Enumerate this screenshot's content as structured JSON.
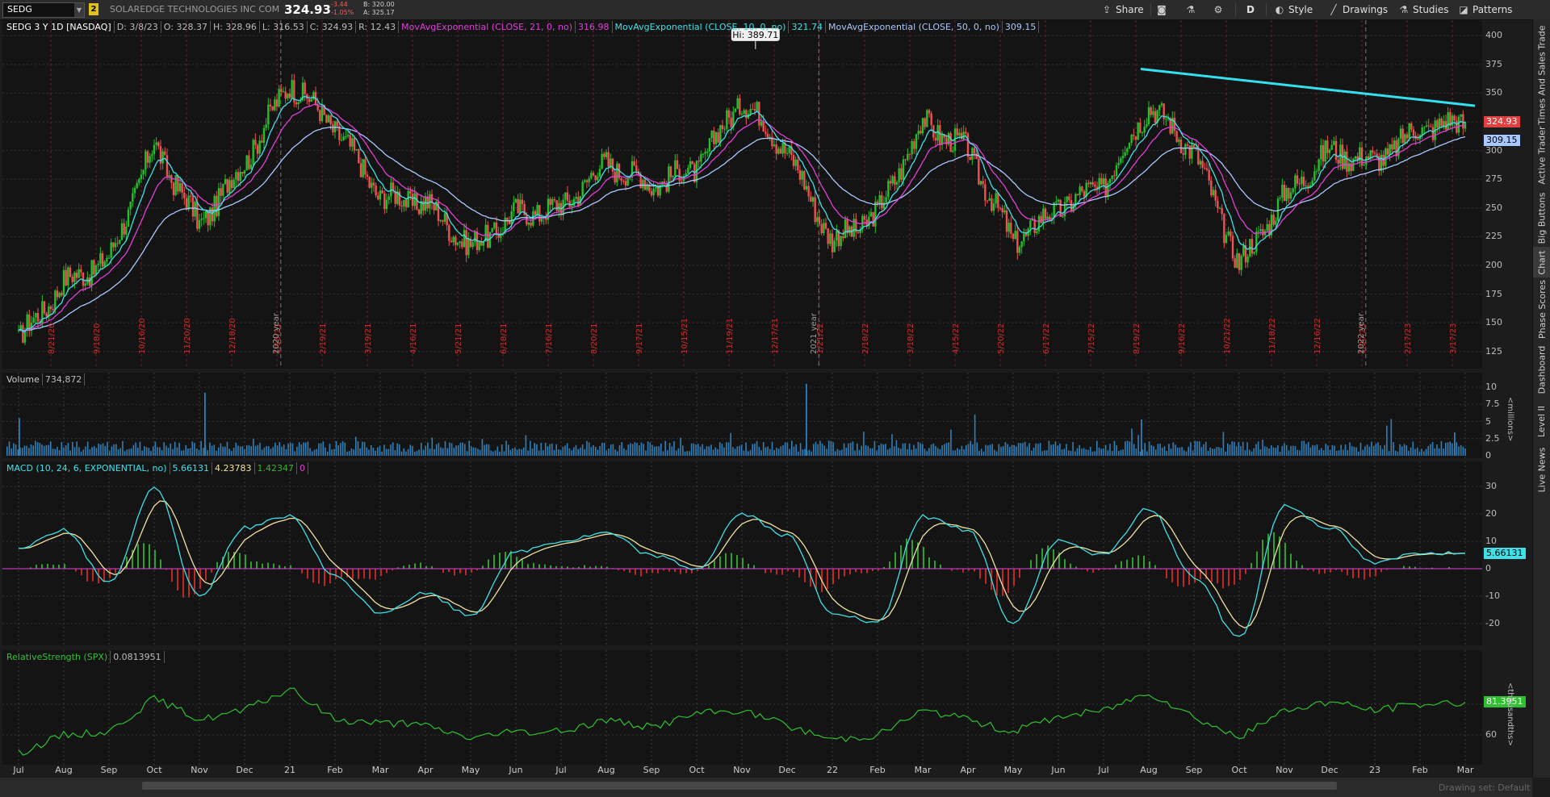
{
  "toolbar": {
    "symbol": "SEDG",
    "link_badge": "2",
    "company": "SOLAREDGE TECHNOLOGIES INC COM",
    "last": "324.93",
    "net_change": "-3.44",
    "pct_change": "-1.05%",
    "bid": "B: 320.00",
    "ask": "A: 325.17",
    "share_label": "Share",
    "period_label": "D",
    "style_label": "Style",
    "drawings_label": "Drawings",
    "studies_label": "Studies",
    "patterns_label": "Patterns"
  },
  "sidebar": {
    "tabs": [
      "Trade",
      "Times And Sales",
      "Active Trader",
      "Big Buttons",
      "Chart",
      "Phase Scores",
      "Dashboard",
      "Level II",
      "Live News"
    ],
    "active": "Chart"
  },
  "price_panel": {
    "header": [
      {
        "text": "SEDG 3 Y 1D [NASDAQ]",
        "color": "#ffffff"
      },
      {
        "text": "D: 3/8/23",
        "color": "#bbbbbb"
      },
      {
        "text": "O: 328.37",
        "color": "#bbbbbb"
      },
      {
        "text": "H: 328.96",
        "color": "#bbbbbb"
      },
      {
        "text": "L: 316.53",
        "color": "#bbbbbb"
      },
      {
        "text": "C: 324.93",
        "color": "#bbbbbb"
      },
      {
        "text": "R: 12.43",
        "color": "#bbbbbb"
      },
      {
        "text": "MovAvgExponential (CLOSE, 21, 0, no)",
        "color": "#e040d8"
      },
      {
        "text": "316.98",
        "color": "#e040d8"
      },
      {
        "text": "MovAvgExponential (CLOSE, 10, 0, no)",
        "color": "#40e0e8"
      },
      {
        "text": "321.74",
        "color": "#40e0e8"
      },
      {
        "text": "MovAvgExponential (CLOSE, 50, 0, no)",
        "color": "#a8c8ff"
      },
      {
        "text": "309.15",
        "color": "#a8c8ff"
      }
    ],
    "hi_label": "Hi: 389.71",
    "last_price_label": "324.93",
    "ma50_label": "309.15",
    "y_ticks": [
      "400",
      "375",
      "350",
      "325",
      "300",
      "275",
      "250",
      "225",
      "200",
      "175",
      "150",
      "125"
    ],
    "vertical_dates": [
      "8/21/20",
      "9/18/20",
      "10/16/20",
      "11/20/20",
      "12/18/20",
      "1/15/21",
      "2/19/21",
      "3/19/21",
      "4/16/21",
      "5/21/21",
      "6/18/21",
      "7/16/21",
      "8/20/21",
      "9/17/21",
      "10/15/21",
      "11/19/21",
      "12/17/21",
      "1/21/22",
      "2/18/22",
      "3/18/22",
      "4/15/22",
      "5/20/22",
      "6/17/22",
      "7/15/22",
      "8/19/22",
      "9/16/22",
      "10/21/22",
      "11/18/22",
      "12/16/22",
      "1/20/23",
      "2/17/23",
      "3/17/23"
    ],
    "year_markers": [
      "2020 year",
      "2021 year",
      "2022 year"
    ]
  },
  "volume_panel": {
    "header": [
      {
        "text": "Volume",
        "color": "#cccccc"
      },
      {
        "text": "734,872",
        "color": "#bbbbbb"
      }
    ],
    "y_ticks": [
      "10",
      "7.5",
      "5",
      "2.5",
      "0"
    ],
    "unit": "<millions>"
  },
  "macd_panel": {
    "header": [
      {
        "text": "MACD (10, 24, 6, EXPONENTIAL, no)",
        "color": "#40e0e8"
      },
      {
        "text": "5.66131",
        "color": "#40e0e8"
      },
      {
        "text": "4.23783",
        "color": "#f0e0a0"
      },
      {
        "text": "1.42347",
        "color": "#3ab03a"
      },
      {
        "text": "0",
        "color": "#e040d8"
      }
    ],
    "y_ticks": [
      "30",
      "20",
      "10",
      "0",
      "-10",
      "-20"
    ],
    "value_label": "5.66131"
  },
  "rs_panel": {
    "header": [
      {
        "text": "RelativeStrength (SPX)",
        "color": "#35c035"
      },
      {
        "text": "0.0813951",
        "color": "#bbbbbb"
      }
    ],
    "y_ticks": [
      "60"
    ],
    "value_label": "81.3951",
    "unit": "<thousandths>"
  },
  "x_axis": [
    "Jul",
    "Aug",
    "Sep",
    "Oct",
    "Nov",
    "Dec",
    "21",
    "Feb",
    "Mar",
    "Apr",
    "May",
    "Jun",
    "Jul",
    "Aug",
    "Sep",
    "Oct",
    "Nov",
    "Dec",
    "22",
    "Feb",
    "Mar",
    "Apr",
    "May",
    "Jun",
    "Jul",
    "Aug",
    "Sep",
    "Oct",
    "Nov",
    "Dec",
    "23",
    "Feb",
    "Mar"
  ],
  "status": {
    "drawing_set": "Drawing set: Default"
  },
  "chart_data": {
    "type": "line",
    "title": "SEDG 3 Y 1D [NASDAQ]",
    "x": [
      "Jul 20",
      "Aug 20",
      "Sep 20",
      "Oct 20",
      "Nov 20",
      "Dec 20",
      "Jan 21",
      "Feb 21",
      "Mar 21",
      "Apr 21",
      "May 21",
      "Jun 21",
      "Jul 21",
      "Aug 21",
      "Sep 21",
      "Oct 21",
      "Nov 21",
      "Dec 21",
      "Jan 22",
      "Feb 22",
      "Mar 22",
      "Apr 22",
      "May 22",
      "Jun 22",
      "Jul 22",
      "Aug 22",
      "Sep 22",
      "Oct 22",
      "Nov 22",
      "Dec 22",
      "Jan 23",
      "Feb 23",
      "Mar 23"
    ],
    "series": [
      {
        "name": "SEDG",
        "values": [
          135,
          185,
          205,
          305,
          235,
          290,
          360,
          320,
          260,
          255,
          215,
          245,
          250,
          290,
          270,
          285,
          345,
          300,
          220,
          245,
          325,
          300,
          220,
          250,
          270,
          340,
          300,
          200,
          260,
          300,
          290,
          320,
          324.93
        ]
      }
    ],
    "ylim": [
      115,
      410
    ],
    "trendline": {
      "from": [
        "Aug 22",
        371
      ],
      "to": [
        "Mar 23",
        339
      ]
    }
  }
}
